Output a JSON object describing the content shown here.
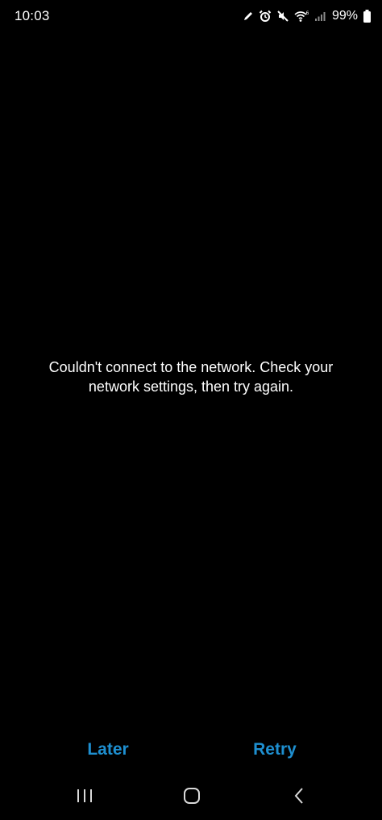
{
  "status_bar": {
    "time": "10:03",
    "battery_percent": "99%",
    "icons": [
      "pen-icon",
      "alarm-icon",
      "mute-icon",
      "wifi-icon",
      "signal-icon",
      "battery-icon"
    ]
  },
  "dialog": {
    "message": "Couldn't connect to the network. Check your network settings, then try again.",
    "later_label": "Later",
    "retry_label": "Retry"
  },
  "nav_bar": {
    "icons": [
      "recents-icon",
      "home-icon",
      "back-icon"
    ]
  },
  "colors": {
    "background": "#000000",
    "text": "#ffffff",
    "accent": "#1e8fd0"
  }
}
